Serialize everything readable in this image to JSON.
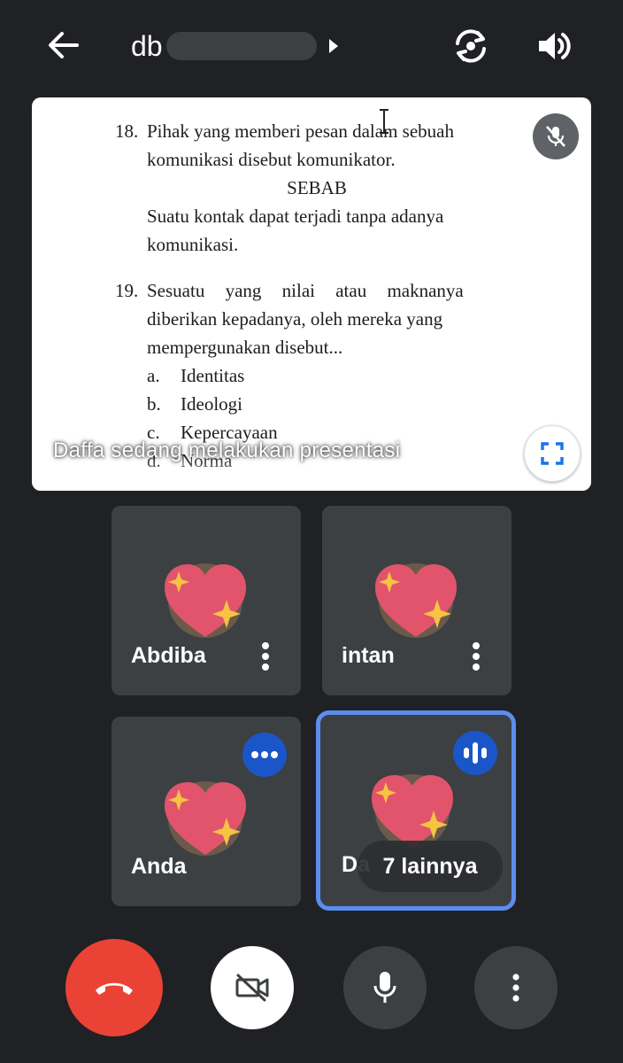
{
  "header": {
    "meeting_title": "db",
    "back_icon": "arrow-left-icon",
    "switch_camera_icon": "switch-camera-icon",
    "speaker_icon": "volume-icon"
  },
  "presentation": {
    "q18": {
      "number": "18.",
      "line1": "Pihak yang memberi pesan dalam sebuah",
      "line2": "komunikasi disebut komunikator.",
      "sebab": "SEBAB",
      "line3": "Suatu kontak dapat terjadi tanpa adanya",
      "line4": "komunikasi."
    },
    "q19": {
      "number": "19.",
      "line1": "Sesuatu yang nilai atau maknanya",
      "line2": "diberikan kepadanya, oleh mereka yang",
      "line3": "mempergunakan disebut...",
      "options": [
        {
          "letter": "a.",
          "text": "Identitas"
        },
        {
          "letter": "b.",
          "text": "Ideologi"
        },
        {
          "letter": "c.",
          "text": "Kepercayaan"
        },
        {
          "letter": "d.",
          "text": "Norma"
        }
      ]
    },
    "caption": "Daffa sedang melakukan presentasi"
  },
  "participants": [
    {
      "name": "Abdiba"
    },
    {
      "name": "intan"
    },
    {
      "name": "Anda"
    },
    {
      "name": "Da"
    }
  ],
  "others_label": "7 lainnya",
  "colors": {
    "background": "#202124",
    "tile": "#3c4043",
    "active_speaker_border": "#5b8def",
    "badge_blue": "#1a56c7",
    "end_call_red": "#ea4335"
  }
}
